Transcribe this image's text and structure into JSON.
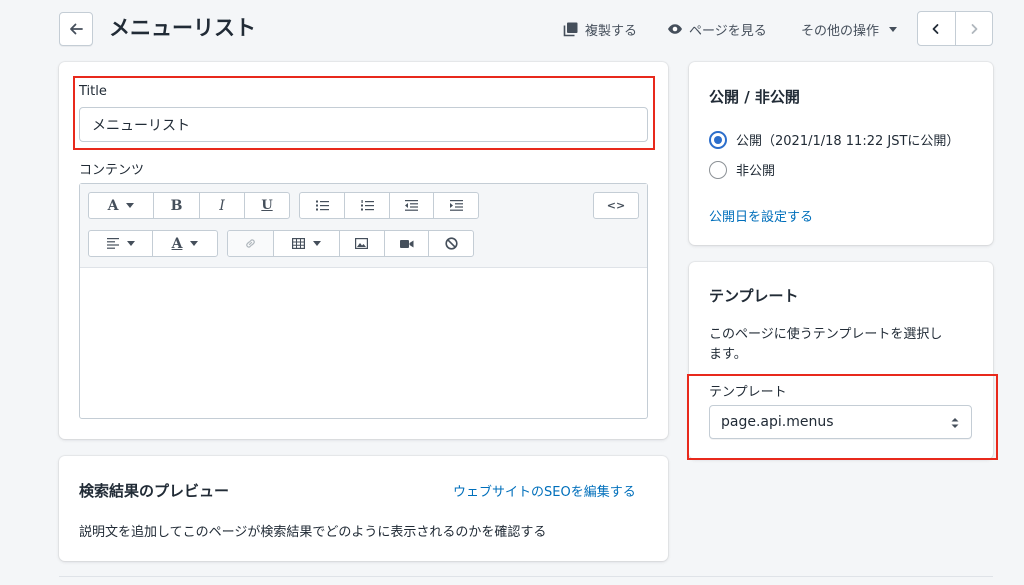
{
  "header": {
    "title": "メニューリスト",
    "duplicate_label": "複製する",
    "view_label": "ページを見る",
    "more_actions_label": "その他の操作"
  },
  "main": {
    "title_field": {
      "label": "Title",
      "value": "メニューリスト"
    },
    "content_field": {
      "label": "コンテンツ"
    },
    "toolbar": {
      "font_label": "A",
      "bold_label": "B",
      "italic_label": "I",
      "underline_label": "U",
      "html_label": "<>",
      "color_label": "A"
    }
  },
  "seo": {
    "title": "検索結果のプレビュー",
    "edit_link": "ウェブサイトのSEOを編集する",
    "description": "説明文を追加してこのページが検索結果でどのように表示されるのかを確認する"
  },
  "visibility": {
    "title": "公開 / 非公開",
    "options": [
      {
        "label": "公開（2021/1/18 11:22 JSTに公開）",
        "selected": true
      },
      {
        "label": "非公開",
        "selected": false
      }
    ],
    "set_date_link": "公開日を設定する"
  },
  "template": {
    "title": "テンプレート",
    "description_line1": "このページに使うテンプレートを選択し",
    "description_line2": "ます。",
    "select_label": "テンプレート",
    "select_value": "page.api.menus"
  },
  "colors": {
    "accent": "#2c6ecb",
    "link": "#006fbb",
    "highlight": "#e8291c"
  },
  "icons": [
    "arrow-left-icon",
    "duplicate-icon",
    "eye-icon",
    "chevron-left-icon",
    "chevron-right-icon",
    "link-icon",
    "table-icon",
    "image-icon",
    "video-icon",
    "block-icon",
    "list-icon",
    "indent-icon",
    "align-left-icon",
    "select-arrows-icon"
  ]
}
